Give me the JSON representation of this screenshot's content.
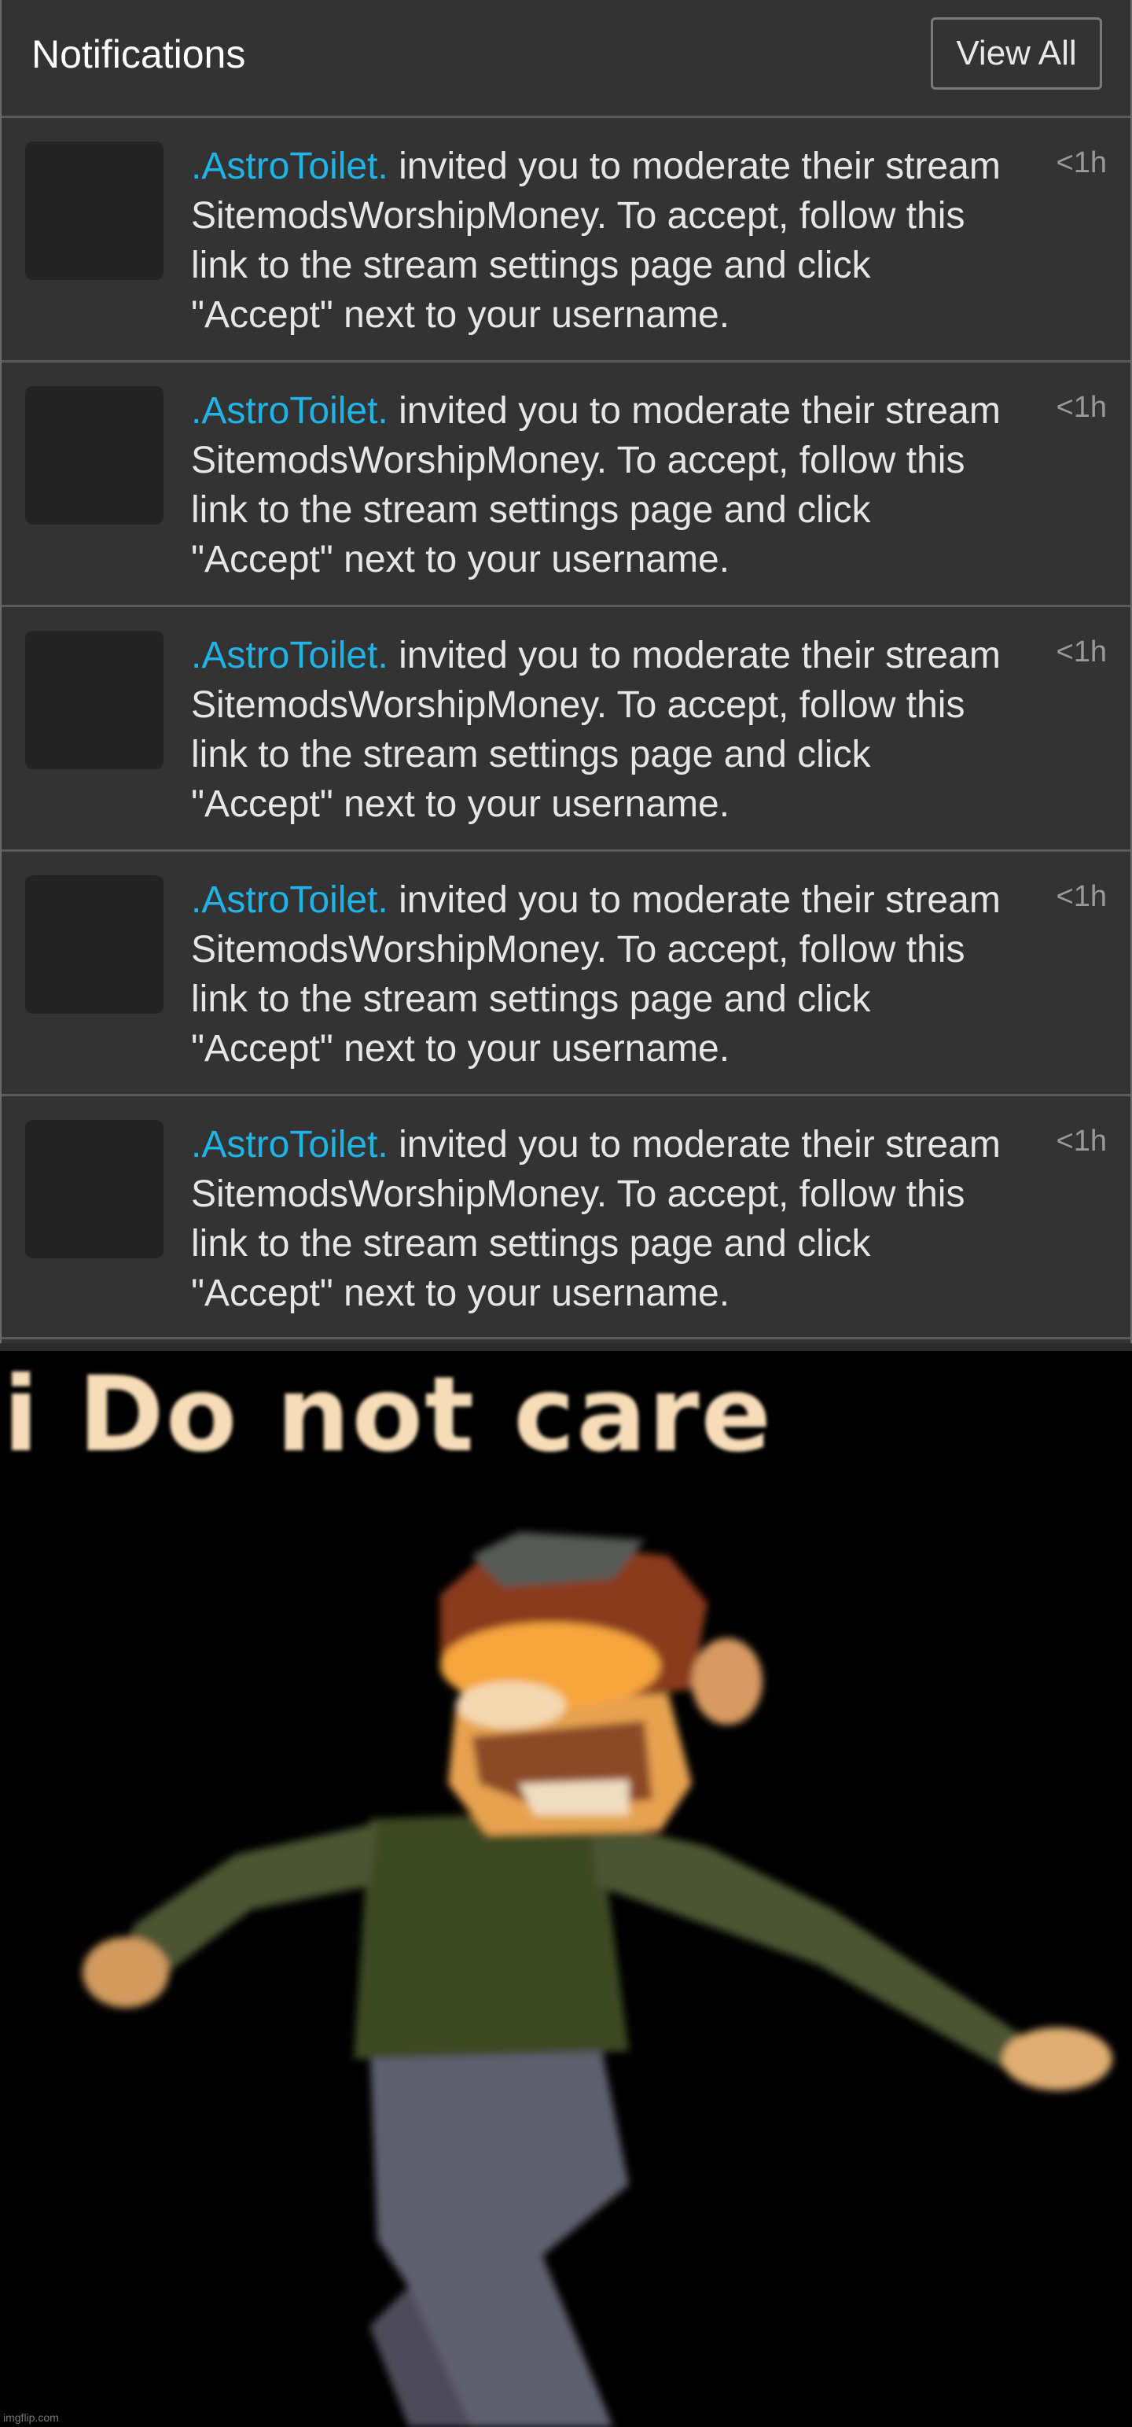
{
  "notifications_panel": {
    "title": "Notifications",
    "view_all_label": "View All",
    "items": [
      {
        "username": ".AstroToilet.",
        "message": " invited you to moderate their stream SitemodsWorshipMoney. To accept, follow this link to the stream settings page and click \"Accept\" next to your username.",
        "time": "<1h"
      },
      {
        "username": ".AstroToilet.",
        "message": " invited you to moderate their stream SitemodsWorshipMoney. To accept, follow this link to the stream settings page and click \"Accept\" next to your username.",
        "time": "<1h"
      },
      {
        "username": ".AstroToilet.",
        "message": " invited you to moderate their stream SitemodsWorshipMoney. To accept, follow this link to the stream settings page and click \"Accept\" next to your username.",
        "time": "<1h"
      },
      {
        "username": ".AstroToilet.",
        "message": " invited you to moderate their stream SitemodsWorshipMoney. To accept, follow this link to the stream settings page and click \"Accept\" next to your username.",
        "time": "<1h"
      },
      {
        "username": ".AstroToilet.",
        "message": " invited you to moderate their stream SitemodsWorshipMoney. To accept, follow this link to the stream settings page and click \"Accept\" next to your username.",
        "time": "<1h"
      }
    ]
  },
  "meme": {
    "caption": "i Do not care",
    "watermark": "imgflip.com"
  },
  "colors": {
    "panel_bg": "#333333",
    "avatar_bg": "#232323",
    "username_link": "#1fb3e8",
    "caption": "#f6dcb8"
  }
}
